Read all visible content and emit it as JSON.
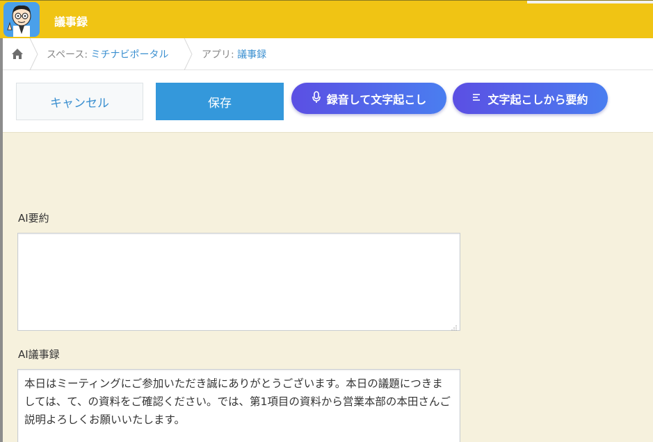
{
  "app": {
    "title": "議事録",
    "icon": "cartoon-avatar-icon"
  },
  "breadcrumb": {
    "home_icon": "home-icon",
    "space_prefix": "スペース: ",
    "space_name": "ミチナビポータル",
    "app_prefix": "アプリ: ",
    "app_name": "議事録"
  },
  "toolbar": {
    "cancel_label": "キャンセル",
    "save_label": "保存",
    "record_label": "録音して文字起こし",
    "record_icon": "microphone-icon",
    "summary_label": "文字起こしから要約",
    "summary_icon": "text-lines-icon"
  },
  "form": {
    "summary_label": "AI要約",
    "summary_value": "",
    "minutes_label": "AI議事録",
    "minutes_value": "本日はミーティングにご参加いただき誠にありがとうございます。本日の議題につきましては、て、の資料をご確認ください。では、第1項目の資料から営業本部の本田さんご説明よろしくお願いいたします。"
  },
  "colors": {
    "header_bg": "#f0c414",
    "form_bg": "#f6f1dd",
    "save_bg": "#3498db",
    "link": "#3a8fd0",
    "pill_gradient_start": "#5b4fe3",
    "pill_gradient_end": "#4a7ef0"
  }
}
